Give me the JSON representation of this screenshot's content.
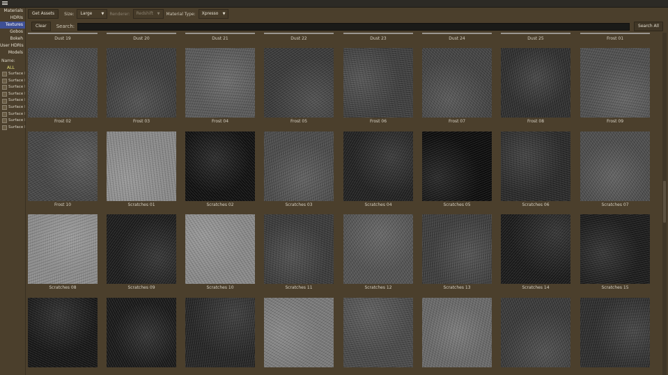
{
  "menu_icon": "hamburger-icon",
  "sidebar": {
    "categories": [
      "Materials",
      "HDRIs",
      "Textures",
      "Gobos",
      "Bokeh",
      "User HDRIs",
      "Models"
    ],
    "active_category": "Textures",
    "name_label": "Name:",
    "all_label": "ALL",
    "filters": [
      "Surface I",
      "Surface I",
      "Surface I",
      "Surface I",
      "Surface I",
      "Surface I",
      "Surface I",
      "Surface I",
      "Surface I"
    ]
  },
  "toolbar": {
    "get_assets": "Get Assets",
    "size_label": "Size:",
    "size_value": "Large",
    "renderer_label": "Renderer:",
    "renderer_value": "Redshift",
    "material_type_label": "Material Type:",
    "material_type_value": "Xpresso"
  },
  "search": {
    "clear": "Clear",
    "label": "Search:",
    "value": "",
    "search_all": "Search All"
  },
  "partial_row": [
    "Dust 19",
    "Dust 20",
    "Dust 21",
    "Dust 22",
    "Dust 23",
    "Dust 24",
    "Dust 25",
    "Frost 01"
  ],
  "rows": [
    [
      "Frost 02",
      "Frost 03",
      "Frost 04",
      "Frost 05",
      "Frost 06",
      "Frost 07",
      "Frost 08",
      "Frost 09"
    ],
    [
      "Frost 10",
      "Scratches 01",
      "Scratches 02",
      "Scratches 03",
      "Scratches 04",
      "Scratches 05",
      "Scratches 06",
      "Scratches 07"
    ],
    [
      "Scratches 08",
      "Scratches 09",
      "Scratches 10",
      "Scratches 11",
      "Scratches 12",
      "Scratches 13",
      "Scratches 14",
      "Scratches 15"
    ],
    [
      "",
      "",
      "",
      "",
      "",
      "",
      "",
      ""
    ]
  ],
  "thumb_tones": [
    [
      "#4a4a4a",
      "#3d3d3d",
      "#5a5a5a",
      "#3a3a3a",
      "#3f3f3f",
      "#444444",
      "#2f2f2f",
      "#505050"
    ],
    [
      "#474747",
      "#8a8a8a",
      "#111111",
      "#4c4c4c",
      "#222222",
      "#0d0d0d",
      "#2a2a2a",
      "#4e4e4e"
    ],
    [
      "#8c8c8c",
      "#1d1d1d",
      "#8a8a8a",
      "#3b3b3b",
      "#545454",
      "#3e3e3e",
      "#1b1b1b",
      "#1c1c1c"
    ],
    [
      "#171717",
      "#1a1a1a",
      "#262626",
      "#7a7a7a",
      "#4a4a4a",
      "#6a6a6a",
      "#3a3a3a",
      "#2e2e2e"
    ]
  ]
}
